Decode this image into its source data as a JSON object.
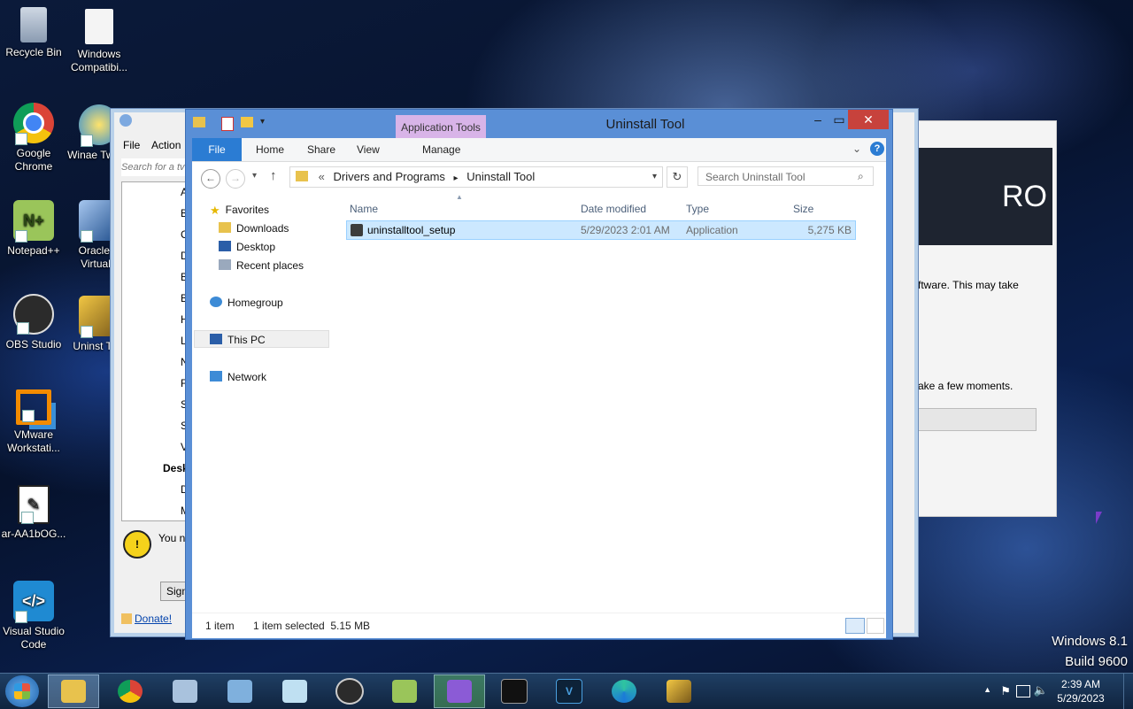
{
  "desktop": {
    "icons_left": [
      {
        "label": "Recycle Bin"
      },
      {
        "label": "Google Chrome"
      },
      {
        "label": "Notepad++"
      },
      {
        "label": "OBS Studio"
      },
      {
        "label": "VMware Workstati..."
      },
      {
        "label": "ar-AA1bOG..."
      },
      {
        "label": "Visual Studio Code"
      }
    ],
    "icons_second": [
      {
        "label": "Windows Compatibi..."
      },
      {
        "label": "Winae Tweak"
      },
      {
        "label": "Oracle V VirtualB"
      },
      {
        "label": "Uninst Tool"
      }
    ],
    "watermark": {
      "line1": "Windows 8.1",
      "line2": "Build 9600"
    }
  },
  "back_window": {
    "menu": [
      "File",
      "Action"
    ],
    "search_placeholder": "Search for a tv",
    "tree_letters": [
      "A",
      "B",
      "C",
      "D",
      "B",
      "B",
      "H",
      "L",
      "N",
      "F",
      "S",
      "S",
      "V"
    ],
    "desk_label": "Desk",
    "tree_letters2": [
      "D",
      "M"
    ],
    "warning_text": "You ne",
    "sign_button": "Sign",
    "donate_link": "Donate!"
  },
  "right_window": {
    "brand_text": "RO",
    "text1": "ftware. This may take",
    "text2": "ake a few moments."
  },
  "explorer": {
    "title": "Uninstall Tool",
    "context_tab": "Application Tools",
    "tabs": {
      "file": "File",
      "home": "Home",
      "share": "Share",
      "view": "View",
      "manage": "Manage"
    },
    "path": {
      "prefix": "«",
      "segment1": "Drivers and Programs",
      "segment2": "Uninstall Tool"
    },
    "search_placeholder": "Search Uninstall Tool",
    "nav": {
      "favorites": "Favorites",
      "downloads": "Downloads",
      "desktop": "Desktop",
      "recent": "Recent places",
      "homegroup": "Homegroup",
      "thispc": "This PC",
      "network": "Network"
    },
    "columns": {
      "name": "Name",
      "date": "Date modified",
      "type": "Type",
      "size": "Size"
    },
    "files": [
      {
        "name": "uninstalltool_setup",
        "date": "5/29/2023 2:01 AM",
        "type": "Application",
        "size": "5,275 KB"
      }
    ],
    "status": {
      "count": "1 item",
      "selected": "1 item selected  5.15 MB"
    }
  },
  "taskbar": {
    "clock_time": "2:39 AM",
    "clock_date": "5/29/2023"
  },
  "colors": {
    "accent": "#2b7cd3",
    "context_tab": "#d8b4e8",
    "selection": "#cce8ff",
    "close": "#c7423c"
  }
}
